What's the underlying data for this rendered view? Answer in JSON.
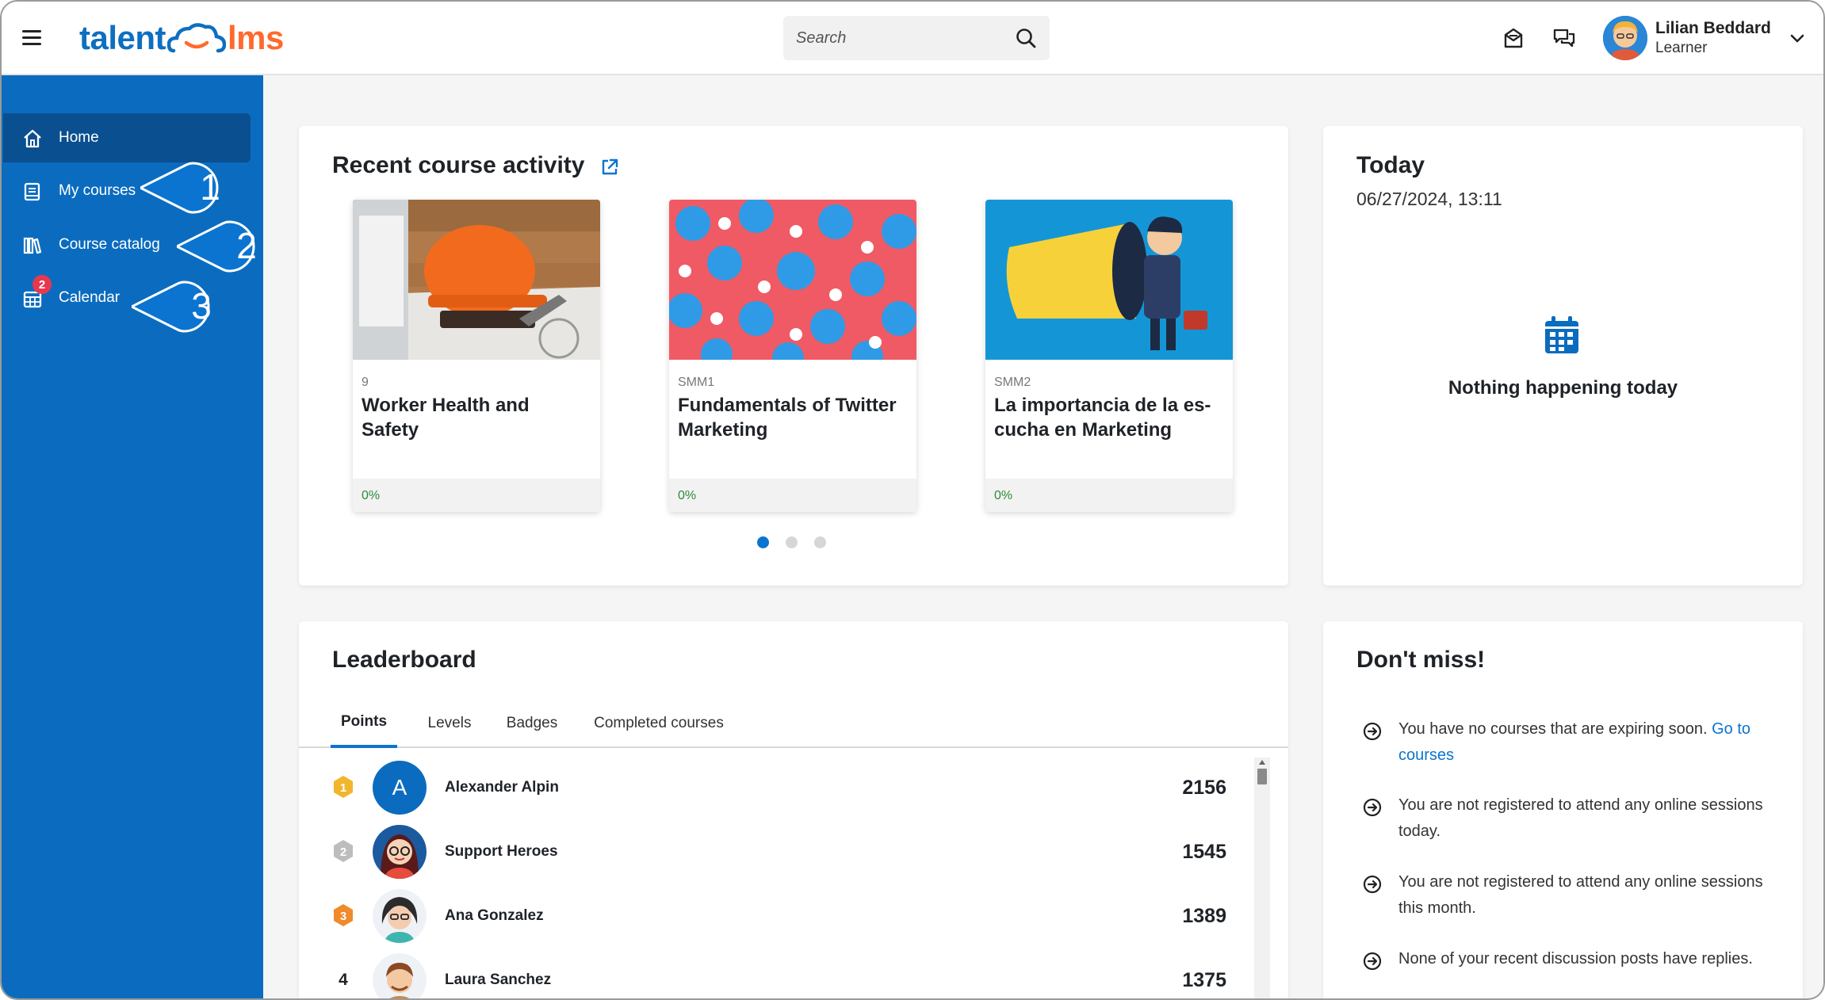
{
  "header": {
    "logo_left": "talent",
    "logo_right": "lms",
    "search_placeholder": "Search",
    "user_name": "Lilian Beddard",
    "user_role": "Learner"
  },
  "sidebar": {
    "items": [
      {
        "label": "Home",
        "icon": "home-icon",
        "active": true
      },
      {
        "label": "My courses",
        "icon": "book-icon",
        "active": false
      },
      {
        "label": "Course catalog",
        "icon": "library-icon",
        "active": false
      },
      {
        "label": "Calendar",
        "icon": "calendar-icon",
        "active": false,
        "badge": "2"
      }
    ],
    "callouts": [
      "1",
      "2",
      "3"
    ]
  },
  "recent": {
    "title": "Recent course activity",
    "courses": [
      {
        "code": "9",
        "name": "Worker Health and Safety",
        "progress": "0%"
      },
      {
        "code": "SMM1",
        "name": "Fundamentals of Twitter Marketing",
        "progress": "0%"
      },
      {
        "code": "SMM2",
        "name": "La importancia de la es-cucha en Marketing",
        "progress": "0%"
      }
    ],
    "pages": 3,
    "current_page": 1
  },
  "today": {
    "title": "Today",
    "datetime": "06/27/2024, 13:11",
    "empty_text": "Nothing happening today"
  },
  "leaderboard": {
    "title": "Leaderboard",
    "tabs": [
      "Points",
      "Levels",
      "Badges",
      "Completed courses"
    ],
    "active_tab": "Points",
    "rows": [
      {
        "rank": "1",
        "name": "Alexander Alpin",
        "score": "2156",
        "initial": "A"
      },
      {
        "rank": "2",
        "name": "Support Heroes",
        "score": "1545"
      },
      {
        "rank": "3",
        "name": "Ana Gonzalez",
        "score": "1389"
      },
      {
        "rank": "4",
        "name": "Laura Sanchez",
        "score": "1375"
      }
    ]
  },
  "dont_miss": {
    "title": "Don't miss!",
    "items": [
      {
        "text": "You have no courses that are expiring soon. ",
        "link": "Go to courses"
      },
      {
        "text": "You are not registered to attend any online sessions today."
      },
      {
        "text": "You are not registered to attend any online sessions this month."
      },
      {
        "text": "None of your recent discussion posts have replies."
      }
    ]
  },
  "colors": {
    "sidebar": "#0b6cbf",
    "sidebar_active": "#0a4f8f",
    "accent": "#0b74d0",
    "logo_orange": "#ff6a2c",
    "progress_green": "#2e8b3a",
    "badge_red": "#e8384f"
  }
}
